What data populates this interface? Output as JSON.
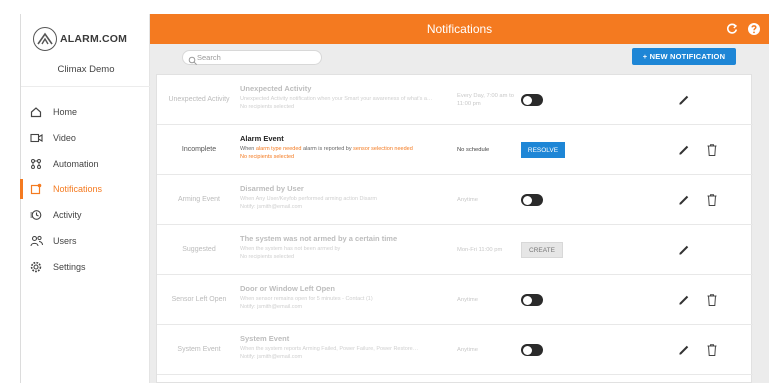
{
  "app": {
    "brand": "ALARM.COM",
    "account_name": "Climax Demo"
  },
  "sidebar": {
    "items": [
      {
        "label": "Home",
        "icon": "home-icon"
      },
      {
        "label": "Video",
        "icon": "video-camera-icon"
      },
      {
        "label": "Automation",
        "icon": "automation-icon"
      },
      {
        "label": "Notifications",
        "icon": "notifications-icon",
        "active": true
      },
      {
        "label": "Activity",
        "icon": "activity-icon"
      },
      {
        "label": "Users",
        "icon": "users-icon"
      },
      {
        "label": "Settings",
        "icon": "settings-gear-icon"
      }
    ]
  },
  "header": {
    "title": "Notifications"
  },
  "toolbar": {
    "search_placeholder": "Search",
    "new_notification_label": "+ NEW NOTIFICATION"
  },
  "rows": [
    {
      "status": "Unexpected Activity",
      "title": "Unexpected Activity",
      "desc1": "Unexpected Activity notification when your Smart your awareness of what's a…",
      "desc2": "No recipients selected",
      "schedule": "Every Day, 7:00 am to 11:00 pm",
      "action": "toggle"
    },
    {
      "status": "Incomplete",
      "title": "Alarm Event",
      "desc1_a": "When ",
      "desc1_b": "alarm type needed",
      "desc1_c": " alarm is reported by ",
      "desc1_d": "sensor selection needed",
      "desc2": "No recipients selected",
      "schedule": "No schedule",
      "action_label": "RESOLVE"
    },
    {
      "status": "Arming Event",
      "title": "Disarmed by User",
      "desc1": "When Any User/Keyfob performed arming action Disarm",
      "desc2": "Notify: jsmith@email.com",
      "schedule": "Anytime",
      "action": "toggle"
    },
    {
      "status": "Suggested",
      "title": "The system was not armed by a certain time",
      "desc1": "When the system has not been armed by",
      "desc2": "No recipients selected",
      "schedule": "Mon-Fri 11:00 pm",
      "action_label": "CREATE"
    },
    {
      "status": "Sensor Left Open",
      "title": "Door or Window Left Open",
      "desc1": "When sensor remains open for 5 minutes - Contact (1)",
      "desc2": "Notify: jsmith@email.com",
      "schedule": "Anytime",
      "action": "toggle"
    },
    {
      "status": "System Event",
      "title": "System Event",
      "desc1": "When the system reports Arming Failed, Power Failure, Power Restore…",
      "desc2": "Notify: jsmith@email.com",
      "schedule": "Anytime",
      "action": "toggle"
    }
  ],
  "colors": {
    "accent": "#f47a20",
    "primary_button": "#1e86d6"
  }
}
